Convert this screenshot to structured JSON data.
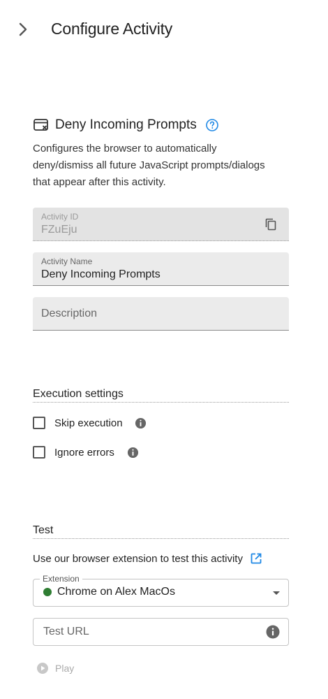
{
  "header": {
    "title": "Configure Activity",
    "collapse_icon": "chevron-right-icon"
  },
  "activity": {
    "icon": "browser-deny-icon",
    "title": "Deny Incoming Prompts",
    "help_icon": "help-circle-icon",
    "description": "Configures the browser to automatically deny/dismiss all future JavaScript prompts/dialogs that appear after this activity."
  },
  "fields": {
    "activity_id": {
      "label": "Activity ID",
      "value": "FZuEju",
      "icon": "copy-icon"
    },
    "activity_name": {
      "label": "Activity Name",
      "value": "Deny Incoming Prompts"
    },
    "description": {
      "placeholder": "Description",
      "value": ""
    }
  },
  "execution": {
    "heading": "Execution settings",
    "options": [
      {
        "label": "Skip execution",
        "checked": false,
        "icon": "info-icon"
      },
      {
        "label": "Ignore errors",
        "checked": false,
        "icon": "info-icon"
      }
    ]
  },
  "test": {
    "heading": "Test",
    "extension_text": "Use our browser extension to test this activity",
    "extension_link_icon": "open-in-new-icon",
    "extension_select": {
      "label": "Extension",
      "value": "Chrome on Alex MacOs",
      "status_color": "#2e7d32"
    },
    "test_url": {
      "placeholder": "Test URL",
      "icon": "info-icon"
    },
    "play_label": "Play"
  },
  "colors": {
    "accent": "#1e88e5",
    "status_online": "#2e7d32"
  }
}
